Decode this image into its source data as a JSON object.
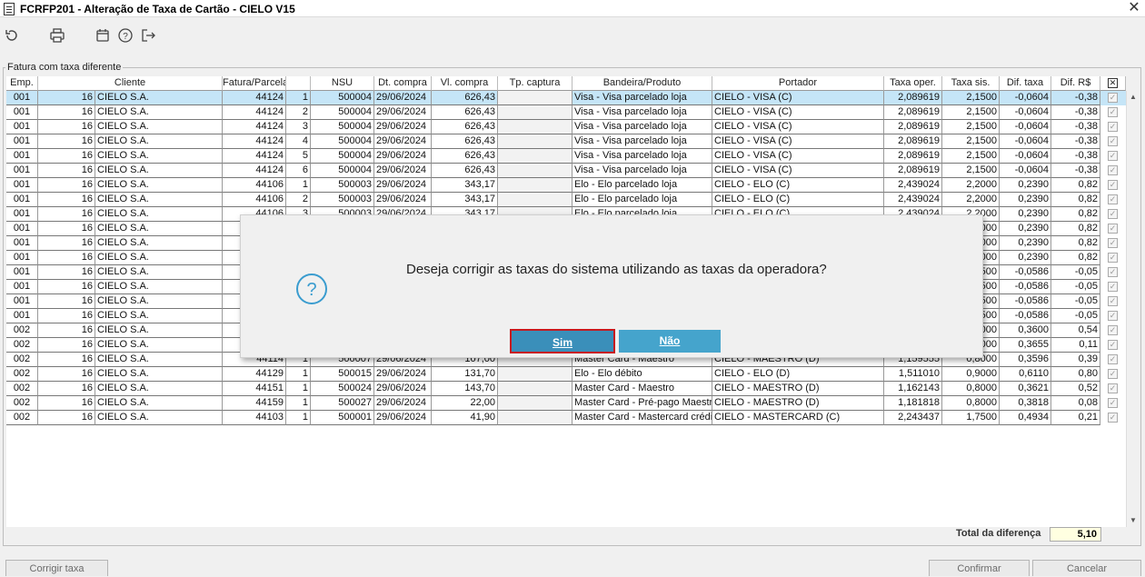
{
  "window": {
    "title": "FCRFP201 - Alteração de Taxa de Cartão - CIELO V15",
    "close": "✕"
  },
  "toolbar": {
    "refresh": "refresh-icon",
    "print": "print-icon",
    "calendar": "calendar-icon",
    "help": "help-icon",
    "exit": "exit-icon"
  },
  "group": {
    "legend": "Fatura com taxa diferente"
  },
  "grid": {
    "headers": [
      "Emp.",
      "Cliente",
      "Fatura/Parcela",
      "",
      "NSU",
      "Dt. compra",
      "Vl. compra",
      "Tp. captura",
      "Bandeira/Produto",
      "Portador",
      "Taxa oper.",
      "Taxa sis.",
      "Dif. taxa",
      "Dif. R$",
      ""
    ],
    "rows": [
      {
        "emp": "001",
        "cod": "16",
        "cliente": "CIELO S.A.",
        "fatura": "44124",
        "parc": "1",
        "nsu": "500004",
        "dt": "29/06/2024",
        "vl": "626,43",
        "tp": "",
        "bandeira": "Visa - Visa parcelado loja",
        "portador": "CIELO - VISA (C)",
        "txop": "2,089619",
        "txsis": "2,1500",
        "dift": "-0,0604",
        "difr": "-0,38"
      },
      {
        "emp": "001",
        "cod": "16",
        "cliente": "CIELO S.A.",
        "fatura": "44124",
        "parc": "2",
        "nsu": "500004",
        "dt": "29/06/2024",
        "vl": "626,43",
        "tp": "",
        "bandeira": "Visa - Visa parcelado loja",
        "portador": "CIELO - VISA (C)",
        "txop": "2,089619",
        "txsis": "2,1500",
        "dift": "-0,0604",
        "difr": "-0,38"
      },
      {
        "emp": "001",
        "cod": "16",
        "cliente": "CIELO S.A.",
        "fatura": "44124",
        "parc": "3",
        "nsu": "500004",
        "dt": "29/06/2024",
        "vl": "626,43",
        "tp": "",
        "bandeira": "Visa - Visa parcelado loja",
        "portador": "CIELO - VISA (C)",
        "txop": "2,089619",
        "txsis": "2,1500",
        "dift": "-0,0604",
        "difr": "-0,38"
      },
      {
        "emp": "001",
        "cod": "16",
        "cliente": "CIELO S.A.",
        "fatura": "44124",
        "parc": "4",
        "nsu": "500004",
        "dt": "29/06/2024",
        "vl": "626,43",
        "tp": "",
        "bandeira": "Visa - Visa parcelado loja",
        "portador": "CIELO - VISA (C)",
        "txop": "2,089619",
        "txsis": "2,1500",
        "dift": "-0,0604",
        "difr": "-0,38"
      },
      {
        "emp": "001",
        "cod": "16",
        "cliente": "CIELO S.A.",
        "fatura": "44124",
        "parc": "5",
        "nsu": "500004",
        "dt": "29/06/2024",
        "vl": "626,43",
        "tp": "",
        "bandeira": "Visa - Visa parcelado loja",
        "portador": "CIELO - VISA (C)",
        "txop": "2,089619",
        "txsis": "2,1500",
        "dift": "-0,0604",
        "difr": "-0,38"
      },
      {
        "emp": "001",
        "cod": "16",
        "cliente": "CIELO S.A.",
        "fatura": "44124",
        "parc": "6",
        "nsu": "500004",
        "dt": "29/06/2024",
        "vl": "626,43",
        "tp": "",
        "bandeira": "Visa - Visa parcelado loja",
        "portador": "CIELO - VISA (C)",
        "txop": "2,089619",
        "txsis": "2,1500",
        "dift": "-0,0604",
        "difr": "-0,38"
      },
      {
        "emp": "001",
        "cod": "16",
        "cliente": "CIELO S.A.",
        "fatura": "44106",
        "parc": "1",
        "nsu": "500003",
        "dt": "29/06/2024",
        "vl": "343,17",
        "tp": "",
        "bandeira": "Elo - Elo parcelado loja",
        "portador": "CIELO - ELO (C)",
        "txop": "2,439024",
        "txsis": "2,2000",
        "dift": "0,2390",
        "difr": "0,82"
      },
      {
        "emp": "001",
        "cod": "16",
        "cliente": "CIELO S.A.",
        "fatura": "44106",
        "parc": "2",
        "nsu": "500003",
        "dt": "29/06/2024",
        "vl": "343,17",
        "tp": "",
        "bandeira": "Elo - Elo parcelado loja",
        "portador": "CIELO - ELO (C)",
        "txop": "2,439024",
        "txsis": "2,2000",
        "dift": "0,2390",
        "difr": "0,82"
      },
      {
        "emp": "001",
        "cod": "16",
        "cliente": "CIELO S.A.",
        "fatura": "44106",
        "parc": "3",
        "nsu": "500003",
        "dt": "29/06/2024",
        "vl": "343,17",
        "tp": "",
        "bandeira": "Elo - Elo parcelado loja",
        "portador": "CIELO - ELO (C)",
        "txop": "2,439024",
        "txsis": "2,2000",
        "dift": "0,2390",
        "difr": "0,82"
      },
      {
        "emp": "001",
        "cod": "16",
        "cliente": "CIELO S.A.",
        "fatura": "",
        "parc": "",
        "nsu": "",
        "dt": "",
        "vl": "",
        "tp": "",
        "bandeira": "",
        "portador": "",
        "txop": "",
        "txsis": "000",
        "dift": "0,2390",
        "difr": "0,82"
      },
      {
        "emp": "001",
        "cod": "16",
        "cliente": "CIELO S.A.",
        "fatura": "",
        "parc": "",
        "nsu": "",
        "dt": "",
        "vl": "",
        "tp": "",
        "bandeira": "",
        "portador": "",
        "txop": "",
        "txsis": "000",
        "dift": "0,2390",
        "difr": "0,82"
      },
      {
        "emp": "001",
        "cod": "16",
        "cliente": "CIELO S.A.",
        "fatura": "",
        "parc": "",
        "nsu": "",
        "dt": "",
        "vl": "",
        "tp": "",
        "bandeira": "",
        "portador": "",
        "txop": "",
        "txsis": "000",
        "dift": "0,2390",
        "difr": "0,82"
      },
      {
        "emp": "001",
        "cod": "16",
        "cliente": "CIELO S.A.",
        "fatura": "",
        "parc": "",
        "nsu": "",
        "dt": "",
        "vl": "",
        "tp": "",
        "bandeira": "",
        "portador": "",
        "txop": "",
        "txsis": "500",
        "dift": "-0,0586",
        "difr": "-0,05"
      },
      {
        "emp": "001",
        "cod": "16",
        "cliente": "CIELO S.A.",
        "fatura": "",
        "parc": "",
        "nsu": "",
        "dt": "",
        "vl": "",
        "tp": "",
        "bandeira": "",
        "portador": "",
        "txop": "",
        "txsis": "500",
        "dift": "-0,0586",
        "difr": "-0,05"
      },
      {
        "emp": "001",
        "cod": "16",
        "cliente": "CIELO S.A.",
        "fatura": "",
        "parc": "",
        "nsu": "",
        "dt": "",
        "vl": "",
        "tp": "",
        "bandeira": "",
        "portador": "",
        "txop": "",
        "txsis": "500",
        "dift": "-0,0586",
        "difr": "-0,05"
      },
      {
        "emp": "001",
        "cod": "16",
        "cliente": "CIELO S.A.",
        "fatura": "",
        "parc": "",
        "nsu": "",
        "dt": "",
        "vl": "",
        "tp": "",
        "bandeira": "",
        "portador": "",
        "txop": "",
        "txsis": "500",
        "dift": "-0,0586",
        "difr": "-0,05"
      },
      {
        "emp": "002",
        "cod": "16",
        "cliente": "CIELO S.A.",
        "fatura": "",
        "parc": "",
        "nsu": "",
        "dt": "",
        "vl": "",
        "tp": "",
        "bandeira": "",
        "portador": "",
        "txop": "",
        "txsis": "000",
        "dift": "0,3600",
        "difr": "0,54"
      },
      {
        "emp": "002",
        "cod": "16",
        "cliente": "CIELO S.A.",
        "fatura": "",
        "parc": "",
        "nsu": "",
        "dt": "",
        "vl": "",
        "tp": "",
        "bandeira": "",
        "portador": "",
        "txop": "",
        "txsis": "000",
        "dift": "0,3655",
        "difr": "0,11"
      },
      {
        "emp": "002",
        "cod": "16",
        "cliente": "CIELO S.A.",
        "fatura": "44114",
        "parc": "1",
        "nsu": "500007",
        "dt": "29/06/2024",
        "vl": "107,00",
        "tp": "",
        "bandeira": "Master Card - Maestro",
        "portador": "CIELO - MAESTRO (D)",
        "txop": "1,159555",
        "txsis": "0,8000",
        "dift": "0,3596",
        "difr": "0,39"
      },
      {
        "emp": "002",
        "cod": "16",
        "cliente": "CIELO S.A.",
        "fatura": "44129",
        "parc": "1",
        "nsu": "500015",
        "dt": "29/06/2024",
        "vl": "131,70",
        "tp": "",
        "bandeira": "Elo - Elo débito",
        "portador": "CIELO - ELO (D)",
        "txop": "1,511010",
        "txsis": "0,9000",
        "dift": "0,6110",
        "difr": "0,80"
      },
      {
        "emp": "002",
        "cod": "16",
        "cliente": "CIELO S.A.",
        "fatura": "44151",
        "parc": "1",
        "nsu": "500024",
        "dt": "29/06/2024",
        "vl": "143,70",
        "tp": "",
        "bandeira": "Master Card - Maestro",
        "portador": "CIELO - MAESTRO (D)",
        "txop": "1,162143",
        "txsis": "0,8000",
        "dift": "0,3621",
        "difr": "0,52"
      },
      {
        "emp": "002",
        "cod": "16",
        "cliente": "CIELO S.A.",
        "fatura": "44159",
        "parc": "1",
        "nsu": "500027",
        "dt": "29/06/2024",
        "vl": "22,00",
        "tp": "",
        "bandeira": "Master Card - Pré-pago Maestro",
        "portador": "CIELO - MAESTRO (D)",
        "txop": "1,181818",
        "txsis": "0,8000",
        "dift": "0,3818",
        "difr": "0,08"
      },
      {
        "emp": "002",
        "cod": "16",
        "cliente": "CIELO S.A.",
        "fatura": "44103",
        "parc": "1",
        "nsu": "500001",
        "dt": "29/06/2024",
        "vl": "41,90",
        "tp": "",
        "bandeira": "Master Card - Mastercard crédito",
        "portador": "CIELO - MASTERCARD (C)",
        "txop": "2,243437",
        "txsis": "1,7500",
        "dift": "0,4934",
        "difr": "0,21"
      }
    ]
  },
  "footer": {
    "total_label": "Total da diferença",
    "total_value": "5,10",
    "corrigir": "Corrigir taxa",
    "confirmar": "Confirmar",
    "cancelar": "Cancelar"
  },
  "dialog": {
    "message": "Deseja corrigir as taxas do sistema utilizando as taxas da operadora?",
    "sim": "Sim",
    "nao": "Não",
    "icon": "question-icon"
  }
}
